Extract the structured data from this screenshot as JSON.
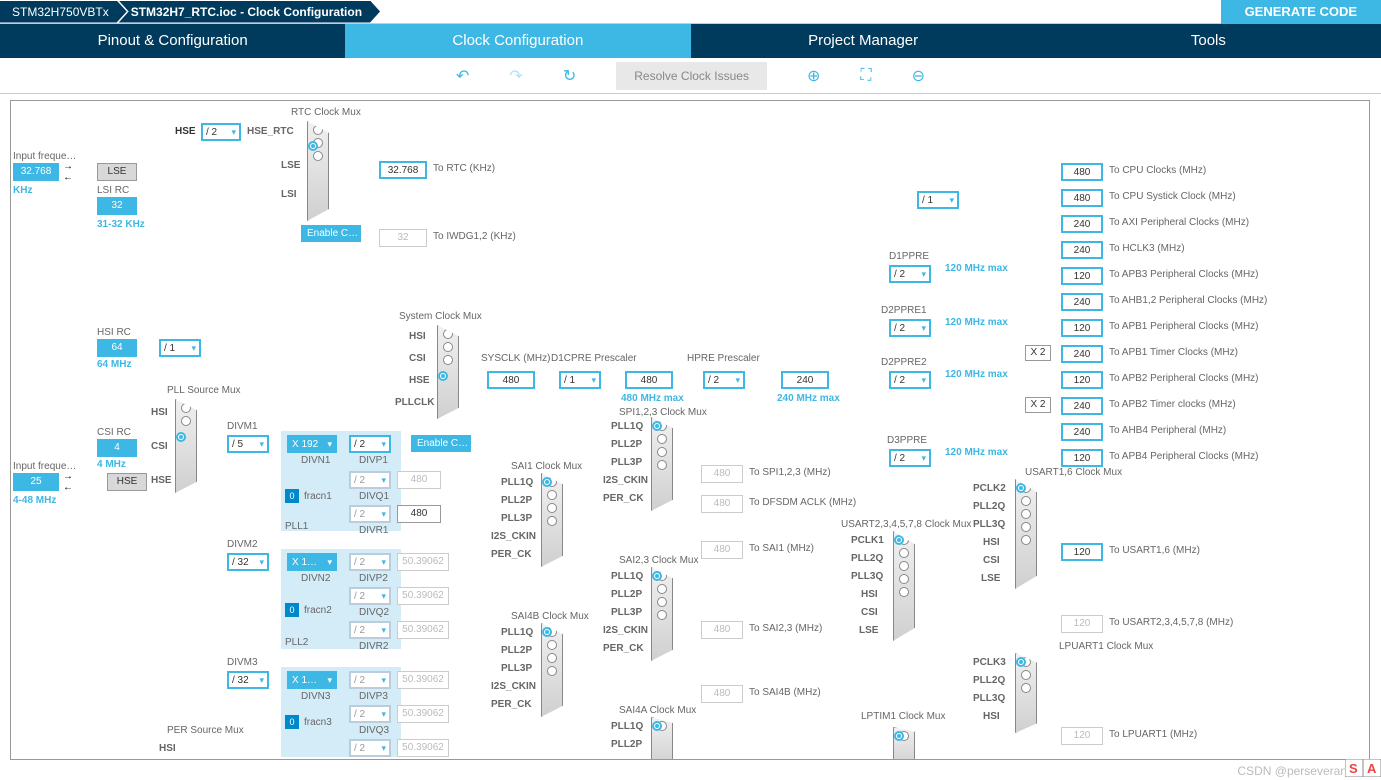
{
  "breadcrumb": {
    "chip": "STM32H750VBTx",
    "file": "STM32H7_RTC.ioc - Clock Configuration"
  },
  "generate": "GENERATE CODE",
  "tabs": {
    "pinout": "Pinout & Configuration",
    "clock": "Clock Configuration",
    "project": "Project Manager",
    "tools": "Tools"
  },
  "toolbar": {
    "resolve": "Resolve Clock Issues"
  },
  "inputs": {
    "lse_label": "Input freque…",
    "lse_val": "32.768",
    "lse_unit": "KHz",
    "lse": "LSE",
    "lsi_rc": "LSI RC",
    "lsi_val": "32",
    "lsi_range": "31-32 KHz",
    "hse_div": "/ 2",
    "hse_lbl": "HSE",
    "hse_rtc": "HSE_RTC",
    "lse_lbl": "LSE",
    "lsi_lbl": "LSI",
    "rtc_title": "RTC Clock Mux",
    "rtc_out": "32.768",
    "rtc_to": "To RTC (KHz)",
    "iwdg_out": "32",
    "iwdg_to": "To IWDG1,2 (KHz)",
    "enable_css": "Enable C…",
    "hsi_rc": "HSI RC",
    "hsi_val": "64",
    "hsi_hint": "64 MHz",
    "hsi_div": "/ 1",
    "csi_rc": "CSI RC",
    "csi_val": "4",
    "csi_hint": "4 MHz",
    "hse_label": "Input freque…",
    "hse_val": "25",
    "hse_range": "4-48 MHz",
    "hse_box": "HSE"
  },
  "pllmux": {
    "title": "PLL Source Mux",
    "hsi": "HSI",
    "csi": "CSI",
    "hse": "HSE"
  },
  "pll": {
    "divm1": "DIVM1",
    "divm1v": "/ 5",
    "divn1": "DIVN1",
    "divn1v": "X 192",
    "fracn1": "fracn1",
    "fracn1v": "0",
    "divp1": "DIVP1",
    "divp1v": "/ 2",
    "divq1": "DIVQ1",
    "divq1v": "/ 2",
    "divq1o": "480",
    "divr1": "DIVR1",
    "divr1v": "/ 2",
    "divr1o": "480",
    "pll1": "PLL1",
    "divm2": "DIVM2",
    "divm2v": "/ 32",
    "divn2": "DIVN2",
    "divn2v": "X 1…",
    "fracn2": "fracn2",
    "fracn2v": "0",
    "divp2": "DIVP2",
    "divp2v": "/ 2",
    "divp2o": "50.39062",
    "divq2": "DIVQ2",
    "divq2v": "/ 2",
    "divq2o": "50.39062",
    "divr2": "DIVR2",
    "divr2v": "/ 2",
    "divr2o": "50.39062",
    "pll2": "PLL2",
    "divm3": "DIVM3",
    "divm3v": "/ 32",
    "divn3": "DIVN3",
    "divn3v": "X 1…",
    "fracn3": "fracn3",
    "fracn3v": "0",
    "divp3": "DIVP3",
    "divp3v": "/ 2",
    "divp3o": "50.39062",
    "divq3": "DIVQ3",
    "divq3v": "/ 2",
    "divq3o": "50.39062",
    "divr3v": "/ 2",
    "divr3o": "50.39062"
  },
  "sysmux": {
    "title": "System Clock Mux",
    "hsi": "HSI",
    "csi": "CSI",
    "hse": "HSE",
    "pllclk": "PLLCLK",
    "enable_css": "Enable C…",
    "sysclk_lbl": "SYSCLK (MHz)",
    "sysclk": "480",
    "d1cpre_lbl": "D1CPRE Prescaler",
    "d1cpre": "/ 1",
    "d1cpre_out": "480",
    "d1cpre_hint": "480 MHz max",
    "hpre_lbl": "HPRE Prescaler",
    "hpre": "/ 2",
    "hpre_out": "240",
    "hpre_hint": "240 MHz max"
  },
  "outputs": {
    "bus_div": "/ 1",
    "cpu": "480",
    "cpu_to": "To CPU Clocks (MHz)",
    "systick": "480",
    "systick_to": "To CPU Systick Clock (MHz)",
    "axi": "240",
    "axi_to": "To AXI Peripheral Clocks (MHz)",
    "hclk3": "240",
    "hclk3_to": "To HCLK3 (MHz)",
    "d1ppre_lbl": "D1PPRE",
    "d1ppre": "/ 2",
    "d1ppre_hint": "120 MHz max",
    "apb3": "120",
    "apb3_to": "To APB3 Peripheral Clocks (MHz)",
    "ahb12": "240",
    "ahb12_to": "To AHB1,2 Peripheral Clocks (MHz)",
    "d2ppre1_lbl": "D2PPRE1",
    "d2ppre1": "/ 2",
    "d2ppre1_hint": "120 MHz max",
    "apb1": "120",
    "apb1_to": "To APB1 Peripheral Clocks (MHz)",
    "x2a": "X 2",
    "apb1t": "240",
    "apb1t_to": "To APB1 Timer Clocks (MHz)",
    "d2ppre2_lbl": "D2PPRE2",
    "d2ppre2": "/ 2",
    "d2ppre2_hint": "120 MHz max",
    "apb2": "120",
    "apb2_to": "To APB2 Peripheral Clocks (MHz)",
    "x2b": "X 2",
    "apb2t": "240",
    "apb2t_to": "To APB2 Timer clocks (MHz)",
    "ahb4": "240",
    "ahb4_to": "To AHB4 Peripheral (MHz)",
    "d3ppre_lbl": "D3PPRE",
    "d3ppre": "/ 2",
    "d3ppre_hint": "120 MHz max",
    "apb4": "120",
    "apb4_to": "To APB4 Peripheral Clocks (MHz)"
  },
  "periph": {
    "spi_title": "SPI1,2,3 Clock Mux",
    "pll1q": "PLL1Q",
    "pll2p": "PLL2P",
    "pll3p": "PLL3P",
    "i2s_ckin": "I2S_CKIN",
    "per_ck": "PER_CK",
    "spi_out": "480",
    "spi_to": "To SPI1,2,3 (MHz)",
    "dfsdm_out": "480",
    "dfsdm_to": "To DFSDM ACLK (MHz)",
    "sai1_title": "SAI1 Clock Mux",
    "sai1_out": "480",
    "sai1_to": "To SAI1 (MHz)",
    "sai23_title": "SAI2,3 Clock Mux",
    "sai23_out": "480",
    "sai23_to": "To SAI2,3 (MHz)",
    "sai4b_title": "SAI4B Clock Mux",
    "sai4b_out": "480",
    "sai4b_to": "To SAI4B (MHz)",
    "sai4a_title": "SAI4A Clock Mux",
    "usart16_title": "USART1,6 Clock Mux",
    "pclk2": "PCLK2",
    "pll2q": "PLL2Q",
    "pll3q": "PLL3Q",
    "hsi": "HSI",
    "csi": "CSI",
    "lse": "LSE",
    "usart16_out": "120",
    "usart16_to": "To USART1,6 (MHz)",
    "usart2_title": "USART2,3,4,5,7,8 Clock Mux",
    "pclk1": "PCLK1",
    "usart2_out": "120",
    "usart2_to": "To USART2,3,4,5,7,8 (MHz)",
    "lpuart_title": "LPUART1 Clock Mux",
    "pclk3": "PCLK3",
    "lpuart_out": "120",
    "lpuart_to": "To LPUART1 (MHz)",
    "lptim_title": "LPTIM1 Clock Mux",
    "persrc_title": "PER Source Mux"
  },
  "watermark": "CSDN @perseverance52"
}
